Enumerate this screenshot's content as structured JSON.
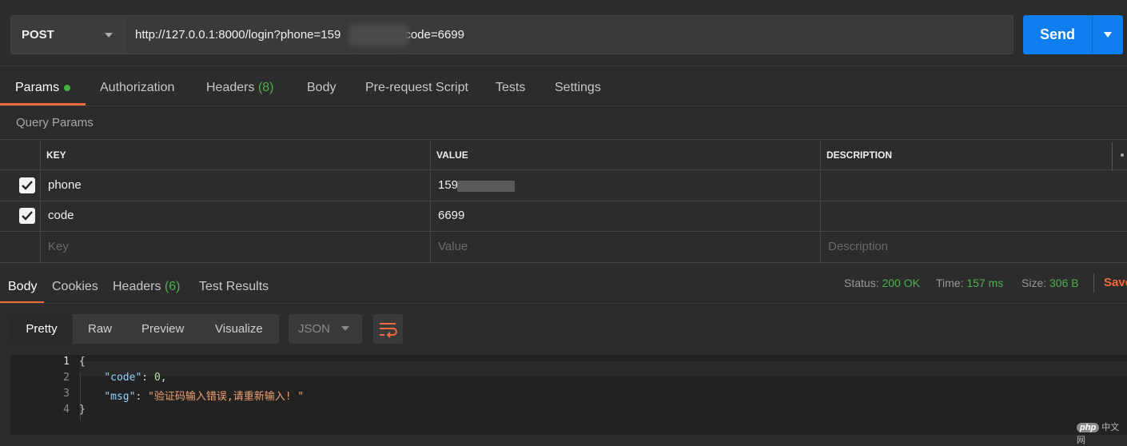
{
  "request": {
    "method": "POST",
    "url_prefix": "http://127.0.0.1:8000/login?phone=159",
    "url_suffix": "&code=6699",
    "send_label": "Send"
  },
  "request_tabs": [
    {
      "label": "Params"
    },
    {
      "label": "Authorization"
    },
    {
      "label": "Headers",
      "count": "(8)"
    },
    {
      "label": "Body"
    },
    {
      "label": "Pre-request Script"
    },
    {
      "label": "Tests"
    },
    {
      "label": "Settings"
    }
  ],
  "query_params": {
    "title": "Query Params",
    "headers": {
      "key": "KEY",
      "value": "VALUE",
      "description": "DESCRIPTION"
    },
    "rows": [
      {
        "key": "phone",
        "value": "159",
        "checked": true
      },
      {
        "key": "code",
        "value": "6699",
        "checked": true
      }
    ],
    "placeholders": {
      "key": "Key",
      "value": "Value",
      "description": "Description"
    }
  },
  "response_tabs": [
    {
      "label": "Body"
    },
    {
      "label": "Cookies"
    },
    {
      "label": "Headers",
      "count": "(6)"
    },
    {
      "label": "Test Results"
    }
  ],
  "status": {
    "status_label": "Status:",
    "status_value": "200 OK",
    "time_label": "Time:",
    "time_value": "157 ms",
    "size_label": "Size:",
    "size_value": "306 B",
    "save_label": "Save"
  },
  "view_modes": [
    "Pretty",
    "Raw",
    "Preview",
    "Visualize"
  ],
  "format": "JSON",
  "code": {
    "line_numbers": [
      "1",
      "2",
      "3",
      "4"
    ],
    "open": "{",
    "close": "}",
    "code_key": "\"code\"",
    "code_value": "0",
    "msg_key": "\"msg\"",
    "msg_value": "\"验证码输入错误,请重新输入! \""
  },
  "watermark": {
    "logo": "php",
    "text": "中文网"
  },
  "colors": {
    "accent": "#f26b3a",
    "send": "#0f7ff0",
    "success": "#4cb24c"
  }
}
